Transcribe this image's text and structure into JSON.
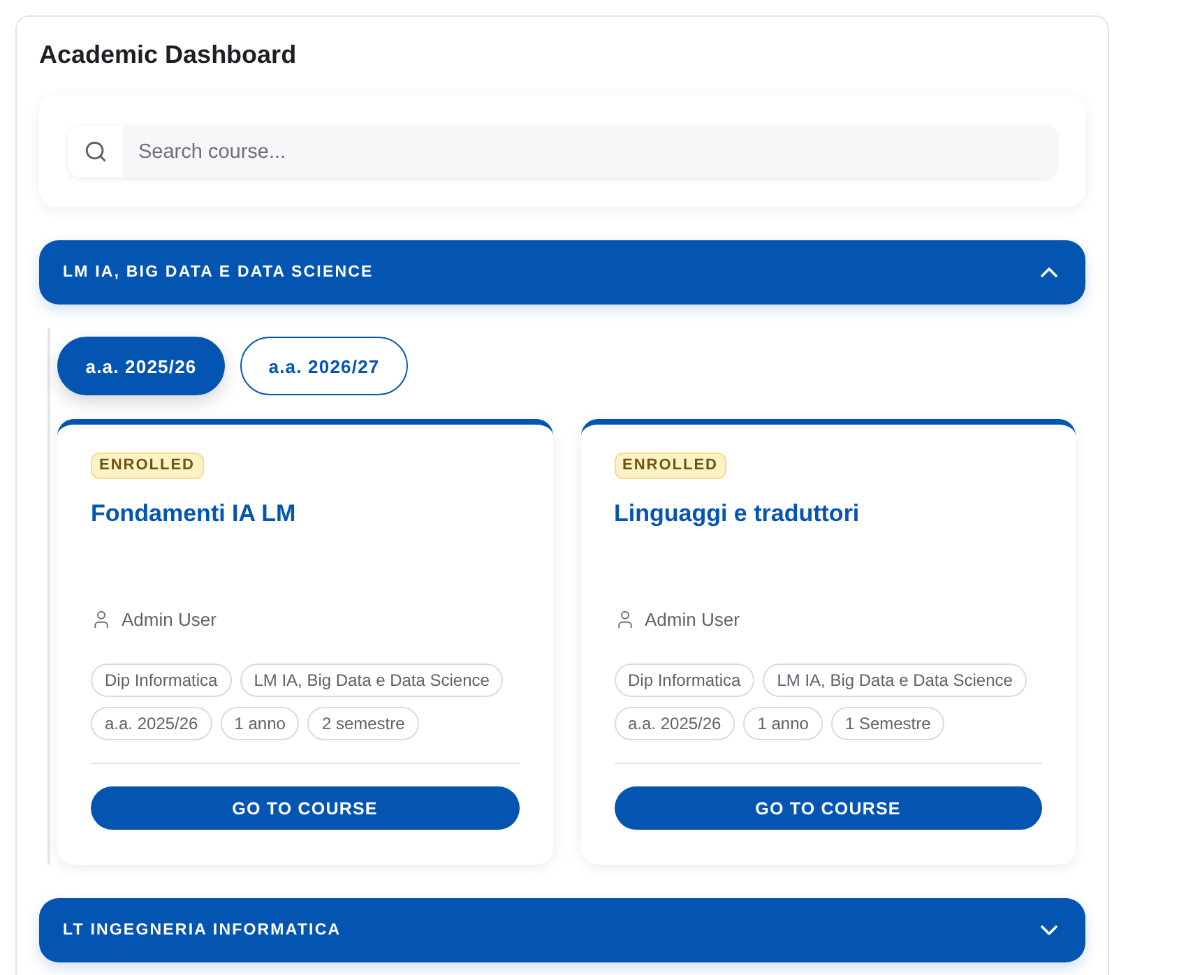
{
  "title": "Academic Dashboard",
  "search": {
    "placeholder": "Search course..."
  },
  "programs": [
    {
      "name": "LM IA, BIG DATA E DATA SCIENCE",
      "expanded": true,
      "years": [
        {
          "label": "a.a. 2025/26",
          "selected": true
        },
        {
          "label": "a.a. 2026/27",
          "selected": false
        }
      ],
      "courses": [
        {
          "status": "ENROLLED",
          "title": "Fondamenti IA LM",
          "teacher": "Admin User",
          "tags": [
            "Dip Informatica",
            "LM IA, Big Data e Data Science",
            "a.a. 2025/26",
            "1 anno",
            "2 semestre"
          ],
          "action": "GO TO COURSE"
        },
        {
          "status": "ENROLLED",
          "title": "Linguaggi e traduttori",
          "teacher": "Admin User",
          "tags": [
            "Dip Informatica",
            "LM IA, Big Data e Data Science",
            "a.a. 2025/26",
            "1 anno",
            "1 Semestre"
          ],
          "action": "GO TO COURSE"
        }
      ]
    },
    {
      "name": "LT INGEGNERIA INFORMATICA",
      "expanded": false
    }
  ]
}
